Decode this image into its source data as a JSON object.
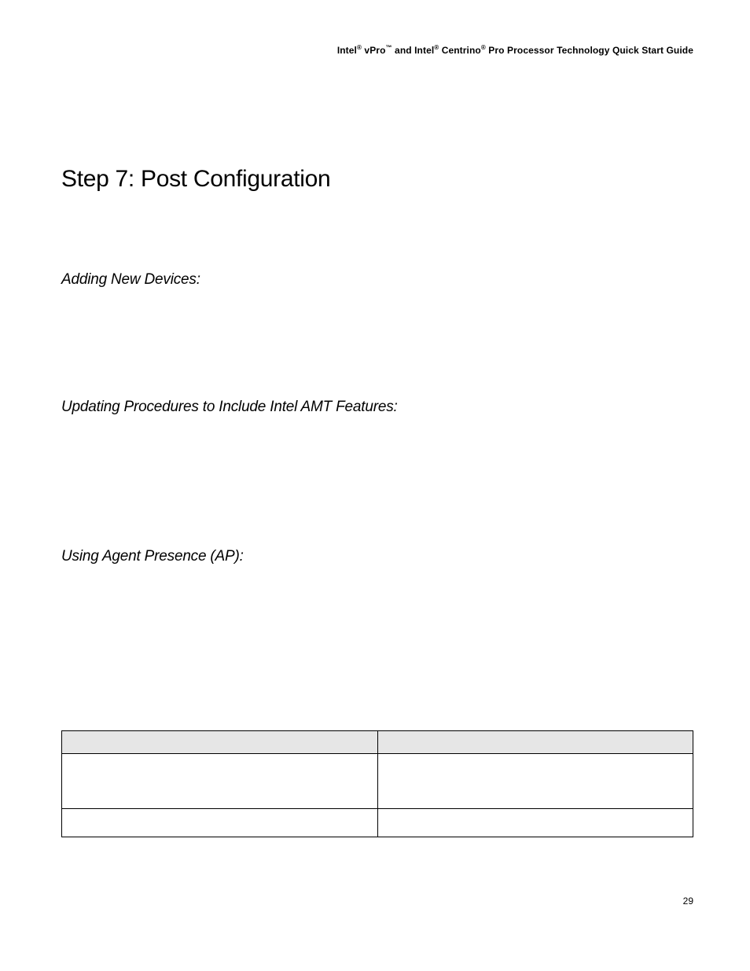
{
  "header": {
    "prefix1": "Intel",
    "reg1": "®",
    "brand1": " vPro",
    "tm": "™",
    "mid": " and Intel",
    "reg2": "®",
    "brand2": " Centrino",
    "reg3": "®",
    "suffix": " Pro Processor Technology Quick Start Guide"
  },
  "title": "Step 7:  Post Configuration",
  "sections": {
    "s1": "Adding New Devices:",
    "s2": "Updating Procedures to Include Intel AMT Features:",
    "s3": "Using Agent Presence (AP):"
  },
  "page_number": "29"
}
